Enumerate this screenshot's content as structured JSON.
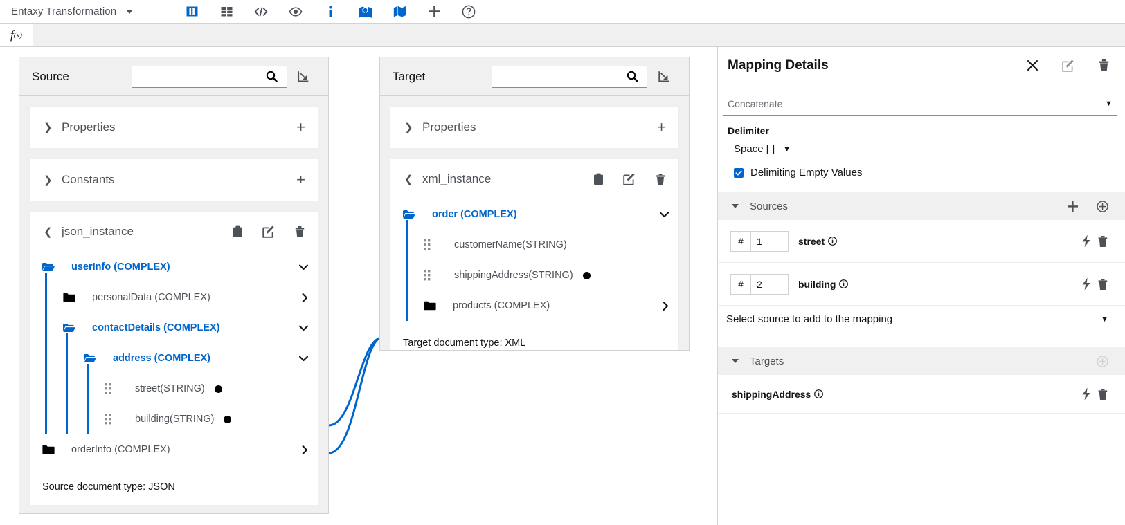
{
  "header": {
    "app_title": "Entaxy Transformation",
    "menu_caret": "caret-down-icon",
    "toolbar_icons": [
      {
        "name": "columns-icon",
        "active": true
      },
      {
        "name": "table-icon",
        "active": false
      },
      {
        "name": "code-icon",
        "active": false
      },
      {
        "name": "eye-icon",
        "active": false
      },
      {
        "name": "info-icon",
        "active": true
      },
      {
        "name": "mapping-marker-icon",
        "active": true
      },
      {
        "name": "map-icon",
        "active": true
      },
      {
        "name": "plus-icon",
        "active": false
      },
      {
        "name": "help-icon",
        "active": false
      }
    ]
  },
  "tabs": {
    "fx_label": "f",
    "fx_sub": "(x)"
  },
  "source": {
    "title": "Source",
    "search_value": "",
    "search_placeholder": "",
    "sections": [
      {
        "label": "Properties",
        "expanded": false
      },
      {
        "label": "Constants",
        "expanded": false
      }
    ],
    "document": {
      "name": "json_instance",
      "expanded": true,
      "doc_type": "Source document type: JSON",
      "nodes": [
        {
          "label": "userInfo (COMPLEX)",
          "depth": 0,
          "state": "open",
          "mapped": false
        },
        {
          "label": "personalData (COMPLEX)",
          "depth": 1,
          "state": "closed",
          "mapped": false
        },
        {
          "label": "contactDetails (COMPLEX)",
          "depth": 1,
          "state": "open",
          "mapped": false
        },
        {
          "label": "address (COMPLEX)",
          "depth": 2,
          "state": "open",
          "mapped": false
        },
        {
          "label": "street(STRING)",
          "depth": 3,
          "state": "field",
          "mapped": true
        },
        {
          "label": "building(STRING)",
          "depth": 3,
          "state": "field",
          "mapped": true
        },
        {
          "label": "orderInfo (COMPLEX)",
          "depth": 0,
          "state": "closed",
          "mapped": false
        }
      ]
    }
  },
  "target": {
    "title": "Target",
    "search_value": "",
    "search_placeholder": "",
    "sections": [
      {
        "label": "Properties",
        "expanded": false
      }
    ],
    "document": {
      "name": "xml_instance",
      "expanded": true,
      "doc_type": "Target document type: XML",
      "nodes": [
        {
          "label": "order (COMPLEX)",
          "depth": 0,
          "state": "open",
          "mapped": false
        },
        {
          "label": "customerName(STRING)",
          "depth": 1,
          "state": "field",
          "mapped": false
        },
        {
          "label": "shippingAddress(STRING)",
          "depth": 1,
          "state": "field",
          "mapped": true
        },
        {
          "label": "products (COMPLEX)",
          "depth": 1,
          "state": "closed",
          "mapped": false
        }
      ]
    }
  },
  "details": {
    "title": "Mapping Details",
    "action_mode": "Concatenate",
    "delimiter_label": "Delimiter",
    "delimiter_value": "Space [ ]",
    "delimiting_empty_values_label": "Delimiting Empty Values",
    "delimiting_empty_values_checked": true,
    "sources_group": "Sources",
    "targets_group": "Targets",
    "add_source_placeholder": "Select source to add to the mapping",
    "index_prefix": "#",
    "sources": [
      {
        "index": "1",
        "name": "street"
      },
      {
        "index": "2",
        "name": "building"
      }
    ],
    "targets": [
      {
        "name": "shippingAddress"
      }
    ]
  },
  "colors": {
    "accent": "#06c",
    "panel_bg": "#f0f0f0",
    "border": "#d2d2d2",
    "text": "#151515",
    "muted": "#4d5258"
  }
}
